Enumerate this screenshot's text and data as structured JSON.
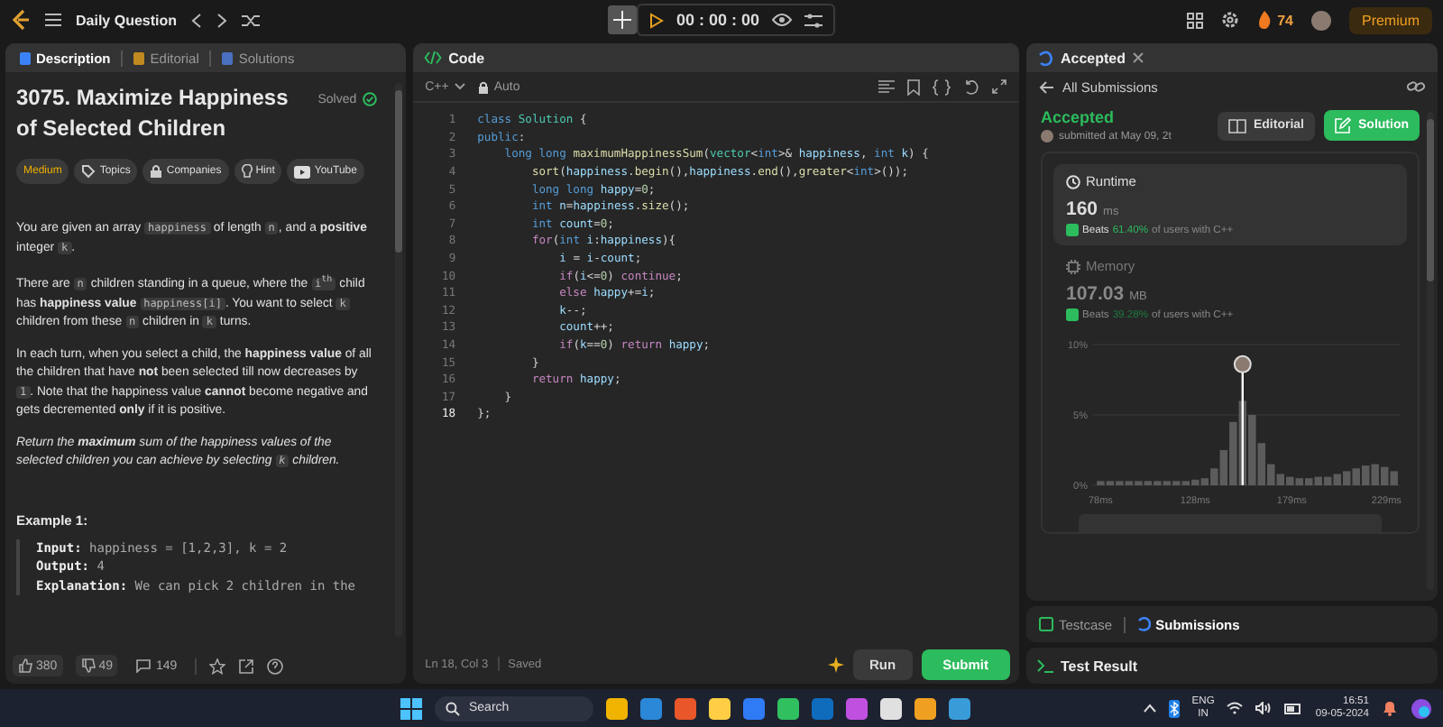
{
  "top_bar": {
    "title": "Daily Question",
    "timer": "00 : 00 : 00",
    "streak": "74",
    "premium": "Premium"
  },
  "problem_panel": {
    "tabs": [
      {
        "label": "Description",
        "selected": true
      },
      {
        "label": "Editorial",
        "selected": false
      },
      {
        "label": "Solutions",
        "selected": false
      }
    ],
    "title": "3075. Maximize Happiness of Selected Children",
    "status": "Solved",
    "tags": [
      {
        "label": "Medium",
        "kind": "difficulty"
      },
      {
        "label": "Topics",
        "kind": "topics"
      },
      {
        "label": "Companies",
        "kind": "companies"
      },
      {
        "label": "Hint",
        "kind": "hint"
      },
      {
        "label": "YouTube",
        "kind": "youtube"
      }
    ],
    "paragraphs": [
      {
        "italic": false,
        "segments": [
          {
            "kind": "text",
            "text": "You are given an array "
          },
          {
            "kind": "code",
            "text": "happiness"
          },
          {
            "kind": "text",
            "text": " of length "
          },
          {
            "kind": "code",
            "text": "n"
          },
          {
            "kind": "text",
            "text": ", and a **positive** integer "
          },
          {
            "kind": "code",
            "text": "k"
          },
          {
            "kind": "text",
            "text": "."
          }
        ]
      },
      {
        "italic": false,
        "segments": [
          {
            "kind": "text",
            "text": "There are "
          },
          {
            "kind": "code",
            "text": "n"
          },
          {
            "kind": "text",
            "text": " children standing in a queue, where the "
          },
          {
            "kind": "code",
            "text": "i$^{th}$"
          },
          {
            "kind": "text",
            "text": " child has **happiness value** "
          },
          {
            "kind": "code",
            "text": "happiness[i]"
          },
          {
            "kind": "text",
            "text": ". You want to select "
          },
          {
            "kind": "code",
            "text": "k"
          },
          {
            "kind": "text",
            "text": " children from these "
          },
          {
            "kind": "code",
            "text": "n"
          },
          {
            "kind": "text",
            "text": " children in "
          },
          {
            "kind": "code",
            "text": "k"
          },
          {
            "kind": "text",
            "text": " turns."
          }
        ]
      },
      {
        "italic": false,
        "segments": [
          {
            "kind": "text",
            "text": "In each turn, when you select a child, the **happiness value** of all the children that have **not** been selected till now decreases by "
          },
          {
            "kind": "code",
            "text": "1"
          },
          {
            "kind": "text",
            "text": ". Note that the happiness value **cannot** become negative and gets decremented **only** if it is positive."
          }
        ]
      },
      {
        "italic": true,
        "segments": [
          {
            "kind": "text",
            "text": "Return the **maximum** sum of the happiness values of the selected children you can achieve by selecting "
          },
          {
            "kind": "code",
            "text": "k"
          },
          {
            "kind": "text",
            "text": " children."
          }
        ]
      }
    ],
    "example": {
      "title": "Example 1:",
      "lines": [
        {
          "label": "Input:",
          "value": "happiness = [1,2,3], k = 2"
        },
        {
          "label": "Output:",
          "value": "4"
        },
        {
          "label": "Explanation:",
          "value": "We can pick 2 children in the"
        }
      ]
    },
    "footer": {
      "likes": "380",
      "dislikes": "49",
      "comments": "149"
    }
  },
  "code_panel": {
    "title": "Code",
    "language": "C++",
    "mode": "Auto",
    "lines": [
      {
        "number": "1",
        "tokens": [
          {
            "kind": "kw",
            "text": "class "
          },
          {
            "kind": "type",
            "text": "Solution"
          },
          {
            "kind": "plain",
            "text": " {"
          }
        ]
      },
      {
        "number": "2",
        "tokens": [
          {
            "kind": "kw",
            "text": "public"
          },
          {
            "kind": "plain",
            "text": ":"
          }
        ]
      },
      {
        "number": "3",
        "tokens": [
          {
            "kind": "kw",
            "text": "    long long "
          },
          {
            "kind": "fn",
            "text": "maximumHappinessSum"
          },
          {
            "kind": "plain",
            "text": "("
          },
          {
            "kind": "type",
            "text": "vector"
          },
          {
            "kind": "plain",
            "text": "<"
          },
          {
            "kind": "kw",
            "text": "int"
          },
          {
            "kind": "plain",
            "text": ">& "
          },
          {
            "kind": "var",
            "text": "happiness"
          },
          {
            "kind": "plain",
            "text": ", "
          },
          {
            "kind": "kw",
            "text": "int "
          },
          {
            "kind": "var",
            "text": "k"
          },
          {
            "kind": "plain",
            "text": ") {"
          }
        ]
      },
      {
        "number": "4",
        "tokens": [
          {
            "kind": "fn",
            "text": "        sort"
          },
          {
            "kind": "plain",
            "text": "("
          },
          {
            "kind": "var",
            "text": "happiness"
          },
          {
            "kind": "plain",
            "text": "."
          },
          {
            "kind": "fn",
            "text": "begin"
          },
          {
            "kind": "plain",
            "text": "(),"
          },
          {
            "kind": "var",
            "text": "happiness"
          },
          {
            "kind": "plain",
            "text": "."
          },
          {
            "kind": "fn",
            "text": "end"
          },
          {
            "kind": "plain",
            "text": "(),"
          },
          {
            "kind": "fn",
            "text": "greater"
          },
          {
            "kind": "plain",
            "text": "<"
          },
          {
            "kind": "kw",
            "text": "int"
          },
          {
            "kind": "plain",
            "text": ">());"
          }
        ]
      },
      {
        "number": "5",
        "tokens": [
          {
            "kind": "kw",
            "text": "        long long "
          },
          {
            "kind": "var",
            "text": "happy"
          },
          {
            "kind": "plain",
            "text": "="
          },
          {
            "kind": "num",
            "text": "0"
          },
          {
            "kind": "plain",
            "text": ";"
          }
        ]
      },
      {
        "number": "6",
        "tokens": [
          {
            "kind": "kw",
            "text": "        int "
          },
          {
            "kind": "var",
            "text": "n"
          },
          {
            "kind": "plain",
            "text": "="
          },
          {
            "kind": "var",
            "text": "happiness"
          },
          {
            "kind": "plain",
            "text": "."
          },
          {
            "kind": "fn",
            "text": "size"
          },
          {
            "kind": "plain",
            "text": "();"
          }
        ]
      },
      {
        "number": "7",
        "tokens": [
          {
            "kind": "kw",
            "text": "        int "
          },
          {
            "kind": "var",
            "text": "count"
          },
          {
            "kind": "plain",
            "text": "="
          },
          {
            "kind": "num",
            "text": "0"
          },
          {
            "kind": "plain",
            "text": ";"
          }
        ]
      },
      {
        "number": "8",
        "tokens": [
          {
            "kind": "ctrl",
            "text": "        for"
          },
          {
            "kind": "plain",
            "text": "("
          },
          {
            "kind": "kw",
            "text": "int "
          },
          {
            "kind": "var",
            "text": "i"
          },
          {
            "kind": "plain",
            "text": ":"
          },
          {
            "kind": "var",
            "text": "happiness"
          },
          {
            "kind": "plain",
            "text": "){"
          }
        ]
      },
      {
        "number": "9",
        "tokens": [
          {
            "kind": "var",
            "text": "            i"
          },
          {
            "kind": "plain",
            "text": " = "
          },
          {
            "kind": "var",
            "text": "i"
          },
          {
            "kind": "plain",
            "text": "-"
          },
          {
            "kind": "var",
            "text": "count"
          },
          {
            "kind": "plain",
            "text": ";"
          }
        ]
      },
      {
        "number": "10",
        "tokens": [
          {
            "kind": "ctrl",
            "text": "            if"
          },
          {
            "kind": "plain",
            "text": "("
          },
          {
            "kind": "var",
            "text": "i"
          },
          {
            "kind": "plain",
            "text": "<="
          },
          {
            "kind": "num",
            "text": "0"
          },
          {
            "kind": "plain",
            "text": ") "
          },
          {
            "kind": "ctrl",
            "text": "continue"
          },
          {
            "kind": "plain",
            "text": ";"
          }
        ]
      },
      {
        "number": "11",
        "tokens": [
          {
            "kind": "ctrl",
            "text": "            else "
          },
          {
            "kind": "var",
            "text": "happy"
          },
          {
            "kind": "plain",
            "text": "+="
          },
          {
            "kind": "var",
            "text": "i"
          },
          {
            "kind": "plain",
            "text": ";"
          }
        ]
      },
      {
        "number": "12",
        "tokens": [
          {
            "kind": "var",
            "text": "            k"
          },
          {
            "kind": "plain",
            "text": "--;"
          }
        ]
      },
      {
        "number": "13",
        "tokens": [
          {
            "kind": "var",
            "text": "            count"
          },
          {
            "kind": "plain",
            "text": "++;"
          }
        ]
      },
      {
        "number": "14",
        "tokens": [
          {
            "kind": "ctrl",
            "text": "            if"
          },
          {
            "kind": "plain",
            "text": "("
          },
          {
            "kind": "var",
            "text": "k"
          },
          {
            "kind": "plain",
            "text": "=="
          },
          {
            "kind": "num",
            "text": "0"
          },
          {
            "kind": "plain",
            "text": ") "
          },
          {
            "kind": "ctrl",
            "text": "return "
          },
          {
            "kind": "var",
            "text": "happy"
          },
          {
            "kind": "plain",
            "text": ";"
          }
        ]
      },
      {
        "number": "15",
        "tokens": [
          {
            "kind": "plain",
            "text": "        }"
          }
        ]
      },
      {
        "number": "16",
        "tokens": [
          {
            "kind": "ctrl",
            "text": "        return "
          },
          {
            "kind": "var",
            "text": "happy"
          },
          {
            "kind": "plain",
            "text": ";"
          }
        ]
      },
      {
        "number": "17",
        "tokens": [
          {
            "kind": "plain",
            "text": "    }"
          }
        ]
      },
      {
        "number": "18",
        "tokens": [
          {
            "kind": "plain",
            "text": "};"
          }
        ]
      }
    ],
    "status": "Ln 18, Col 3",
    "saved": "Saved",
    "run": "Run",
    "submit": "Submit"
  },
  "result_panel": {
    "tab": "Accepted",
    "back": "All Submissions",
    "verdict": "Accepted",
    "submitted": "submitted at May 09, 2t",
    "editorial": "Editorial",
    "solution": "Solution",
    "stats": [
      {
        "kind": "runtime",
        "selected": true,
        "label": "Runtime",
        "value": "160",
        "unit": "ms",
        "beats": "Beats",
        "percent": "61.40%",
        "suffix": "of users with C++"
      },
      {
        "kind": "memory",
        "selected": false,
        "label": "Memory",
        "value": "107.03",
        "unit": "MB",
        "beats": "Beats",
        "percent": "39.28%",
        "suffix": "of users with C++"
      }
    ],
    "chart_data": {
      "type": "bar",
      "x": [
        78,
        83,
        88,
        93,
        98,
        103,
        108,
        113,
        118,
        123,
        128,
        133,
        138,
        143,
        148,
        153,
        158,
        163,
        168,
        173,
        178,
        183,
        188,
        193,
        198,
        203,
        208,
        213,
        218,
        223,
        228,
        233
      ],
      "series": [
        {
          "color": "#5c5c5c",
          "values": [
            0.3,
            0.3,
            0.3,
            0.3,
            0.3,
            0.3,
            0.3,
            0.3,
            0.3,
            0.3,
            0.4,
            0.5,
            1.2,
            2.5,
            4.5,
            6.0,
            5.0,
            3.0,
            1.5,
            0.8,
            0.6,
            0.5,
            0.5,
            0.6,
            0.6,
            0.8,
            1.0,
            1.2,
            1.4,
            1.5,
            1.3,
            1.0
          ]
        }
      ],
      "xlim": [
        74,
        236
      ],
      "ylim": [
        0,
        10
      ],
      "xticks": [
        {
          "value": 78,
          "label": "78ms"
        },
        {
          "value": 128,
          "label": "128ms"
        },
        {
          "value": 179,
          "label": "179ms"
        },
        {
          "value": 229,
          "label": "229ms"
        }
      ],
      "yticks": [
        {
          "value": 0,
          "label": "0%"
        },
        {
          "value": 5,
          "label": "5%"
        },
        {
          "value": 10,
          "label": "10%"
        }
      ],
      "ref_lines": [
        {
          "axis": "x",
          "value": 153
        }
      ]
    },
    "bottom_tabs": [
      {
        "label": "Testcase",
        "selected": false
      },
      {
        "label": "Submissions",
        "selected": true
      }
    ],
    "test_result": "Test Result"
  },
  "taskbar": {
    "search": "Search",
    "language": "ENG",
    "region": "IN",
    "time": "16:51",
    "date": "09-05-2024"
  }
}
